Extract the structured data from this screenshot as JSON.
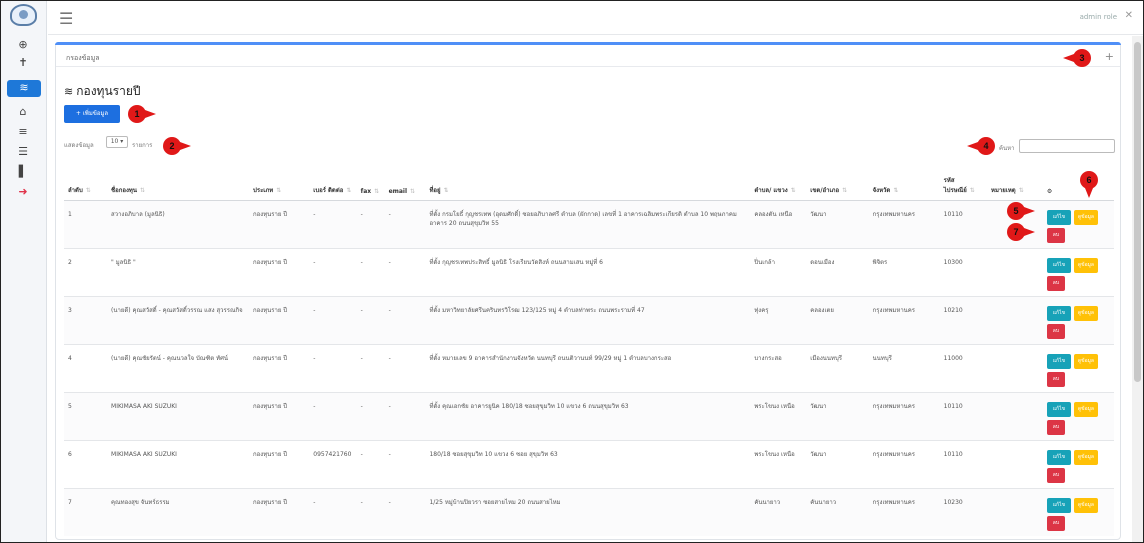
{
  "sidebar": {
    "items": [
      {
        "icon": "dashboard-icon",
        "glyph": "⊕"
      },
      {
        "icon": "person-icon",
        "glyph": "✝"
      },
      {
        "icon": "stack-icon",
        "glyph": "≋",
        "active": true
      },
      {
        "icon": "building-icon",
        "glyph": "⌂"
      },
      {
        "icon": "coins-icon",
        "glyph": "≡"
      },
      {
        "icon": "list-icon",
        "glyph": "☰"
      },
      {
        "icon": "file-icon",
        "glyph": "▌"
      },
      {
        "icon": "logout-icon",
        "glyph": "➜",
        "red": true
      }
    ]
  },
  "topbar": {
    "user": "admin role",
    "close_icon": "✕"
  },
  "panel": {
    "header": "กรองข้อมูล",
    "title": "กองทุนรายปี",
    "add_button": "+ เพิ่มข้อมูล",
    "show_label": "แสดงข้อมูล",
    "show_value": "10",
    "show_after": "รายการ",
    "search_label": "ค้นหา"
  },
  "table": {
    "columns": [
      "ลำดับ",
      "ชื่อกองทุน",
      "ประเภท",
      "เบอร์ ติดต่อ",
      "fax",
      "email",
      "ที่อยู่",
      "ตำบล/ แขวง",
      "เขต/อำเภอ",
      "จังหวัด",
      "รหัส ไปรษณีย์",
      "หมายเหตุ",
      ""
    ],
    "rows": [
      {
        "no": "1",
        "name": "สวางอภิบาล (มูลนิธิ)",
        "type": "กองทุนราย ปี",
        "phone": "-",
        "fax": "-",
        "email": "-",
        "address": "ที่ตั้ง กรมโยธิ์ กุญชรเทพ (อุดมศักดิ์) ซอยอภิบาลศรี ตำบล (ผักกาด) เลขที่ 1 อาคารเฉลิมพระเกียรติ ตำบล 10 พฤษภาคม อาคาร 20 ถนนสุขุมวิท 55",
        "subdistrict": "คลองตัน เหนือ",
        "district": "วัฒนา",
        "province": "กรุงเทพมหานคร",
        "zip": "10110",
        "note": ""
      },
      {
        "no": "2",
        "name": "\" มูลนิธิ \"",
        "type": "กองทุนราย ปี",
        "phone": "-",
        "fax": "-",
        "email": "-",
        "address": "ที่ตั้ง กุญชรเทพประสิทธิ์ มูลนิธิ โรงเรียนวัดสิงห์ ถนนสามเสน หมู่ที่ 6",
        "subdistrict": "ปิ่นเกล้า",
        "district": "ดอนเมือง",
        "province": "พิจิตร",
        "zip": "10300",
        "note": ""
      },
      {
        "no": "3",
        "name": "(นายดี) คุณสวัสดิ์ - คุณสวัสดิ์วรรณ แสง สุวรรณกิจ",
        "type": "กองทุนราย ปี",
        "phone": "-",
        "fax": "-",
        "email": "-",
        "address": "ที่ตั้ง มหาวิทยาลัยศรีนครินทรวิโรฒ 123/125 หมู่ 4 ตำบลท่าพระ ถนนพระรามที่ 47",
        "subdistrict": "ทุ่งครุ",
        "district": "คลองเตย",
        "province": "กรุงเทพมหานคร",
        "zip": "10210",
        "note": ""
      },
      {
        "no": "4",
        "name": "(นายดี) คุณชัยรัตน์ - คุณนวลใจ บัณฑิต ทัศน์",
        "type": "กองทุนราย ปี",
        "phone": "-",
        "fax": "-",
        "email": "-",
        "address": "ที่ตั้ง หมายเลข 9 อาคารสำนักงานจังหวัด นนทบุรี ถนนติวานนท์ 99/29 หมู่ 1 ตำบลบางกระสอ",
        "subdistrict": "บางกระสอ",
        "district": "เมืองนนทบุรี",
        "province": "นนทบุรี",
        "zip": "11000",
        "note": ""
      },
      {
        "no": "5",
        "name": "MIKIMASA AKI SUZUKI",
        "type": "กองทุนราย ปี",
        "phone": "-",
        "fax": "-",
        "email": "-",
        "address": "ที่ตั้ง คุณเอกชัย อาคารยูนิค 180/18 ซอยสุขุมวิท 10 แขวง 6 ถนนสุขุมวิท 63",
        "subdistrict": "พระโขนง เหนือ",
        "district": "วัฒนา",
        "province": "กรุงเทพมหานคร",
        "zip": "10110",
        "note": ""
      },
      {
        "no": "6",
        "name": "MIKIMASA AKI SUZUKI",
        "type": "กองทุนราย ปี",
        "phone": "0957421760",
        "fax": "-",
        "email": "-",
        "address": "180/18 ซอยสุขุมวิท 10 แขวง 6 ซอย สุขุมวิท 63",
        "subdistrict": "พระโขนง เหนือ",
        "district": "วัฒนา",
        "province": "กรุงเทพมหานคร",
        "zip": "10110",
        "note": ""
      },
      {
        "no": "7",
        "name": "คุณทองสุข จันทร์ธรรม",
        "type": "กองทุนราย ปี",
        "phone": "-",
        "fax": "-",
        "email": "-",
        "address": "1/25 หมู่บ้านปิยวรา ซอยสายไหม 20 ถนนสายไหม",
        "subdistrict": "คันนายาว",
        "district": "คันนายาว",
        "province": "กรุงเทพมหานคร",
        "zip": "10230",
        "note": ""
      }
    ],
    "actions": {
      "edit": "แก้ไข",
      "view": "ดูข้อมูล",
      "delete": "ลบ"
    }
  },
  "callouts": [
    "1",
    "2",
    "3",
    "4",
    "5",
    "6",
    "7"
  ],
  "colors": {
    "primary": "#1d6fe0",
    "info": "#17a2b8",
    "warning": "#ffc107",
    "danger": "#dc3545",
    "callout": "#e01818"
  }
}
